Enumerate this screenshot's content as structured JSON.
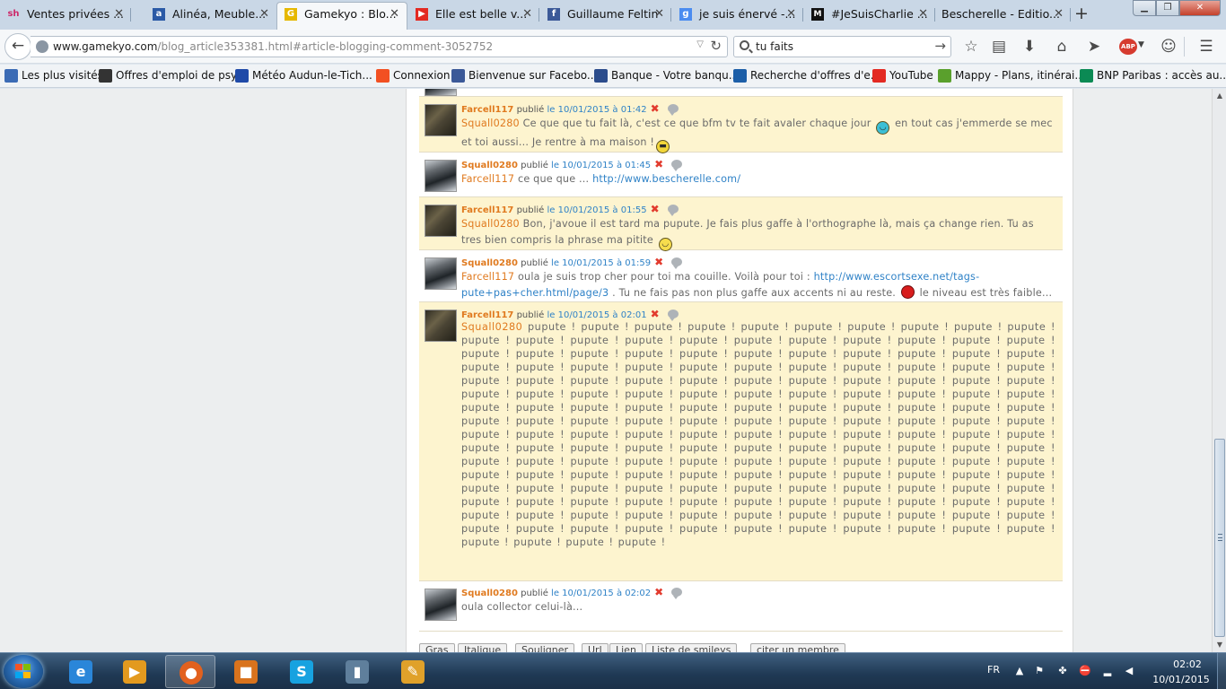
{
  "tabs": [
    {
      "label": "Ventes privées ...",
      "icon": "sh",
      "color": "#cc2a6a"
    },
    {
      "label": "Alinéa, Meuble...",
      "icon": "a",
      "color": "#2b5aa6"
    },
    {
      "label": "Gamekyo : Blo...",
      "icon": "G",
      "color": "#e6b800"
    },
    {
      "label": "Elle est belle v...",
      "icon": "▶",
      "color": "#e32a22"
    },
    {
      "label": "Guillaume Feltin",
      "icon": "f",
      "color": "#3b5998"
    },
    {
      "label": "je suis énervé -...",
      "icon": "g",
      "color": "#4b8cf0"
    },
    {
      "label": "#JeSuisCharlie ...",
      "icon": "M",
      "color": "#111111"
    },
    {
      "label": "Bescherelle - Editio...",
      "icon": "",
      "color": "#d9e2ec"
    }
  ],
  "nav": {
    "url_host": "www.gamekyo.com",
    "url_path": "/blog_article353381.html#article-blogging-comment-3052752",
    "search_value": "tu faits",
    "abp_label": "ABP"
  },
  "bookmarks": [
    {
      "label": "Les plus visités",
      "color": "#3b6bb5"
    },
    {
      "label": "Offres d'emploi de psy...",
      "color": "#333333"
    },
    {
      "label": "Météo Audun-le-Tich...",
      "color": "#1f4aa8"
    },
    {
      "label": "Connexion",
      "color": "#f25022"
    },
    {
      "label": "Bienvenue sur Facebo...",
      "color": "#3b5998"
    },
    {
      "label": "Banque - Votre banqu...",
      "color": "#2b4c8c"
    },
    {
      "label": "Recherche d'offres d'e...",
      "color": "#1d5fa8"
    },
    {
      "label": "YouTube",
      "color": "#e32a22"
    },
    {
      "label": "Mappy - Plans, itinérai...",
      "color": "#5aa02c"
    },
    {
      "label": "BNP Paribas : accès au...",
      "color": "#0b8a54"
    }
  ],
  "comment_meta": {
    "published": "publié"
  },
  "comments": [
    {
      "author": "Farcell117",
      "date": "le 10/01/2015 à 01:42",
      "mention": "Squall0280",
      "text1": " Ce que que tu fait là, c'est ce que bfm tv te fait avaler chaque jour ",
      "text2": " en tout cas j'emmerde se mec et toi aussi... Je rentre à ma maison !"
    },
    {
      "author": "Squall0280",
      "date": "le 10/01/2015 à 01:45",
      "mention": "Farcell117",
      "text1": " ce que que ... ",
      "link": "http://www.bescherelle.com/"
    },
    {
      "author": "Farcell117",
      "date": "le 10/01/2015 à 01:55",
      "mention": "Squall0280",
      "text1": " Bon, j'avoue il est tard ma pupute. Je fais plus gaffe à l'orthographe là, mais ça change rien. Tu as tres bien compris la phrase ma pitite "
    },
    {
      "author": "Squall0280",
      "date": "le 10/01/2015 à 01:59",
      "mention": "Farcell117",
      "text1": " oula je suis trop cher pour toi ma couille. Voilà pour toi : ",
      "link": "http://www.escortsexe.net/tags-pute+pas+cher.html/page/3",
      "text2": " . Tu ne fais pas non plus gaffe aux accents ni au reste. ",
      "text3": " le niveau est très faible..."
    },
    {
      "author": "Farcell117",
      "date": "le 10/01/2015 à 02:01",
      "mention": "Squall0280",
      "repeat_word": "pupute !",
      "repeat_count": 179
    },
    {
      "author": "Squall0280",
      "date": "le 10/01/2015 à 02:02",
      "text1": "oula collector celui-là..."
    }
  ],
  "toolbar_buttons": [
    "Gras",
    "Italique",
    "Souligner",
    "Url",
    "Lien",
    "Liste de smileys",
    "citer un membre"
  ],
  "taskbar": {
    "lang": "FR",
    "time": "02:02",
    "date": "10/01/2015",
    "apps": [
      {
        "name": "ie-icon",
        "glyph": "e",
        "color": "#2a86d9"
      },
      {
        "name": "media-player-icon",
        "glyph": "▶",
        "color": "#e39a1f"
      },
      {
        "name": "firefox-icon",
        "glyph": "●",
        "color": "#e2611e"
      },
      {
        "name": "installer-icon",
        "glyph": "■",
        "color": "#d9731d"
      },
      {
        "name": "skype-icon",
        "glyph": "S",
        "color": "#17a2e0"
      },
      {
        "name": "device-manager-icon",
        "glyph": "▮",
        "color": "#5f7f9c"
      },
      {
        "name": "tool-icon",
        "glyph": "✎",
        "color": "#e0a12a"
      }
    ]
  }
}
